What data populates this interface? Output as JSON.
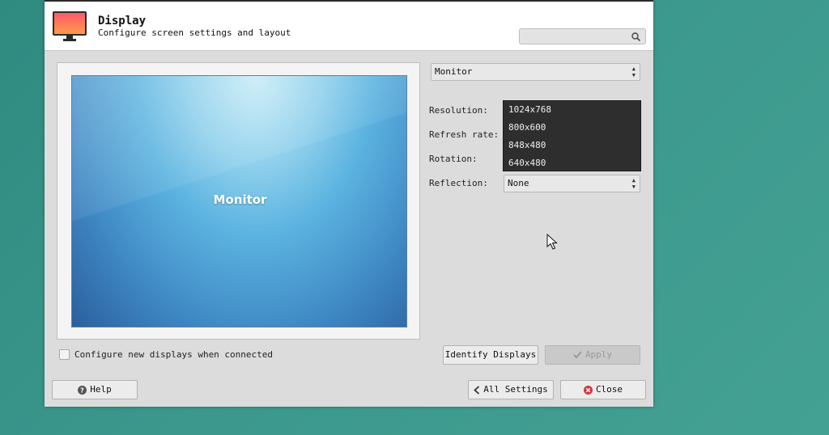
{
  "header": {
    "title": "Display",
    "subtitle": "Configure screen settings and layout",
    "search_placeholder": ""
  },
  "preview": {
    "monitor_label": "Monitor"
  },
  "settings": {
    "monitor_select": "Monitor",
    "resolution_label": "Resolution:",
    "refresh_rate_label": "Refresh rate:",
    "rotation_label": "Rotation:",
    "reflection_label": "Reflection:",
    "reflection_value": "None",
    "resolution_options": [
      "1024x768",
      "800x600",
      "848x480",
      "640x480"
    ]
  },
  "footer": {
    "configure_new_label": "Configure new displays when connected",
    "identify_label": "Identify Displays",
    "apply_label": "Apply",
    "help_label": "Help",
    "all_settings_label": "All Settings",
    "close_label": "Close"
  },
  "colors": {
    "desktop": "#3b978c",
    "dropdown_bg": "#2e2e2e",
    "close_icon": "#d9363e"
  },
  "icons": {
    "app": "display-monitor-icon",
    "search": "search-icon",
    "help": "help-icon",
    "apply": "checkmark-icon",
    "all_settings": "chevron-left-icon",
    "close": "close-icon"
  }
}
